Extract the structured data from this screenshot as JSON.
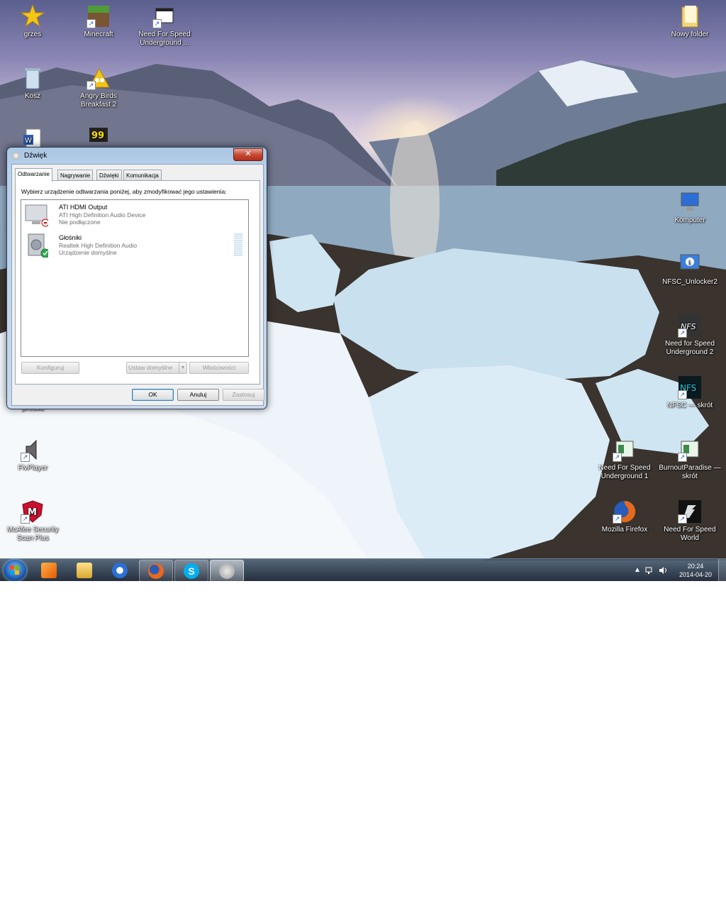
{
  "desktop": {
    "icons": [
      {
        "label": "grzes"
      },
      {
        "label": "Minecraft"
      },
      {
        "label": "Need For Speed Underground ..."
      },
      {
        "label": "Nowy folder"
      },
      {
        "label": "Kosz"
      },
      {
        "label": "Angry Birds Breakfast 2"
      },
      {
        "label": "Komputer"
      },
      {
        "label": "NFSC_Unlocker2"
      },
      {
        "label": "Need for Speed Underground 2"
      },
      {
        "label": "NFSC — skrót"
      },
      {
        "label": "FlvPlayer"
      },
      {
        "label": "Need For Speed Underground 1"
      },
      {
        "label": "BurnoutParadise — skrót"
      },
      {
        "label": "McAfee Security Scan Plus"
      },
      {
        "label": "Mozilla Firefox"
      },
      {
        "label": "Need For Speed World"
      }
    ],
    "partial_label": "prosba"
  },
  "dialog": {
    "title": "Dźwięk",
    "close_label": "✕",
    "tabs": [
      "Odtwarzanie",
      "Nagrywanie",
      "Dźwięki",
      "Komunikacja"
    ],
    "instruction": "Wybierz urządzenie odtwarzania poniżej, aby zmodyfikować jego ustawienia:",
    "devices": [
      {
        "name": "ATI HDMI Output",
        "driver": "ATI High Definition Audio Device",
        "status": "Nie podłączone"
      },
      {
        "name": "Głośniki",
        "driver": "Realtek High Definition Audio",
        "status": "Urządzenie domyślne"
      }
    ],
    "buttons": {
      "configure": "Konfiguruj",
      "set_default": "Ustaw domyślne",
      "properties": "Właściwości",
      "ok": "OK",
      "cancel": "Anuluj",
      "apply": "Zastosuj"
    }
  },
  "taskbar": {
    "time": "20:24",
    "date": "2014-04-20",
    "tray_arrow": "▲"
  }
}
